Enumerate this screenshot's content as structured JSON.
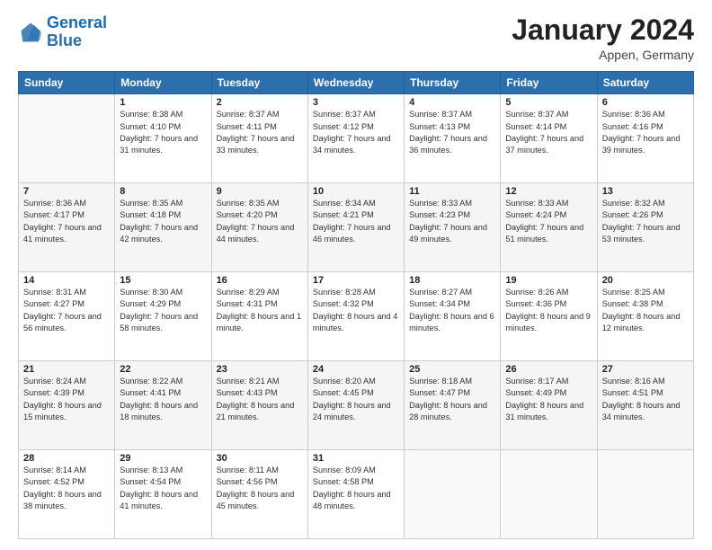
{
  "logo": {
    "line1": "General",
    "line2": "Blue"
  },
  "title": "January 2024",
  "location": "Appen, Germany",
  "days_header": [
    "Sunday",
    "Monday",
    "Tuesday",
    "Wednesday",
    "Thursday",
    "Friday",
    "Saturday"
  ],
  "weeks": [
    [
      {
        "day": "",
        "sunrise": "",
        "sunset": "",
        "daylight": ""
      },
      {
        "day": "1",
        "sunrise": "Sunrise: 8:38 AM",
        "sunset": "Sunset: 4:10 PM",
        "daylight": "Daylight: 7 hours and 31 minutes."
      },
      {
        "day": "2",
        "sunrise": "Sunrise: 8:37 AM",
        "sunset": "Sunset: 4:11 PM",
        "daylight": "Daylight: 7 hours and 33 minutes."
      },
      {
        "day": "3",
        "sunrise": "Sunrise: 8:37 AM",
        "sunset": "Sunset: 4:12 PM",
        "daylight": "Daylight: 7 hours and 34 minutes."
      },
      {
        "day": "4",
        "sunrise": "Sunrise: 8:37 AM",
        "sunset": "Sunset: 4:13 PM",
        "daylight": "Daylight: 7 hours and 36 minutes."
      },
      {
        "day": "5",
        "sunrise": "Sunrise: 8:37 AM",
        "sunset": "Sunset: 4:14 PM",
        "daylight": "Daylight: 7 hours and 37 minutes."
      },
      {
        "day": "6",
        "sunrise": "Sunrise: 8:36 AM",
        "sunset": "Sunset: 4:16 PM",
        "daylight": "Daylight: 7 hours and 39 minutes."
      }
    ],
    [
      {
        "day": "7",
        "sunrise": "Sunrise: 8:36 AM",
        "sunset": "Sunset: 4:17 PM",
        "daylight": "Daylight: 7 hours and 41 minutes."
      },
      {
        "day": "8",
        "sunrise": "Sunrise: 8:35 AM",
        "sunset": "Sunset: 4:18 PM",
        "daylight": "Daylight: 7 hours and 42 minutes."
      },
      {
        "day": "9",
        "sunrise": "Sunrise: 8:35 AM",
        "sunset": "Sunset: 4:20 PM",
        "daylight": "Daylight: 7 hours and 44 minutes."
      },
      {
        "day": "10",
        "sunrise": "Sunrise: 8:34 AM",
        "sunset": "Sunset: 4:21 PM",
        "daylight": "Daylight: 7 hours and 46 minutes."
      },
      {
        "day": "11",
        "sunrise": "Sunrise: 8:33 AM",
        "sunset": "Sunset: 4:23 PM",
        "daylight": "Daylight: 7 hours and 49 minutes."
      },
      {
        "day": "12",
        "sunrise": "Sunrise: 8:33 AM",
        "sunset": "Sunset: 4:24 PM",
        "daylight": "Daylight: 7 hours and 51 minutes."
      },
      {
        "day": "13",
        "sunrise": "Sunrise: 8:32 AM",
        "sunset": "Sunset: 4:26 PM",
        "daylight": "Daylight: 7 hours and 53 minutes."
      }
    ],
    [
      {
        "day": "14",
        "sunrise": "Sunrise: 8:31 AM",
        "sunset": "Sunset: 4:27 PM",
        "daylight": "Daylight: 7 hours and 56 minutes."
      },
      {
        "day": "15",
        "sunrise": "Sunrise: 8:30 AM",
        "sunset": "Sunset: 4:29 PM",
        "daylight": "Daylight: 7 hours and 58 minutes."
      },
      {
        "day": "16",
        "sunrise": "Sunrise: 8:29 AM",
        "sunset": "Sunset: 4:31 PM",
        "daylight": "Daylight: 8 hours and 1 minute."
      },
      {
        "day": "17",
        "sunrise": "Sunrise: 8:28 AM",
        "sunset": "Sunset: 4:32 PM",
        "daylight": "Daylight: 8 hours and 4 minutes."
      },
      {
        "day": "18",
        "sunrise": "Sunrise: 8:27 AM",
        "sunset": "Sunset: 4:34 PM",
        "daylight": "Daylight: 8 hours and 6 minutes."
      },
      {
        "day": "19",
        "sunrise": "Sunrise: 8:26 AM",
        "sunset": "Sunset: 4:36 PM",
        "daylight": "Daylight: 8 hours and 9 minutes."
      },
      {
        "day": "20",
        "sunrise": "Sunrise: 8:25 AM",
        "sunset": "Sunset: 4:38 PM",
        "daylight": "Daylight: 8 hours and 12 minutes."
      }
    ],
    [
      {
        "day": "21",
        "sunrise": "Sunrise: 8:24 AM",
        "sunset": "Sunset: 4:39 PM",
        "daylight": "Daylight: 8 hours and 15 minutes."
      },
      {
        "day": "22",
        "sunrise": "Sunrise: 8:22 AM",
        "sunset": "Sunset: 4:41 PM",
        "daylight": "Daylight: 8 hours and 18 minutes."
      },
      {
        "day": "23",
        "sunrise": "Sunrise: 8:21 AM",
        "sunset": "Sunset: 4:43 PM",
        "daylight": "Daylight: 8 hours and 21 minutes."
      },
      {
        "day": "24",
        "sunrise": "Sunrise: 8:20 AM",
        "sunset": "Sunset: 4:45 PM",
        "daylight": "Daylight: 8 hours and 24 minutes."
      },
      {
        "day": "25",
        "sunrise": "Sunrise: 8:18 AM",
        "sunset": "Sunset: 4:47 PM",
        "daylight": "Daylight: 8 hours and 28 minutes."
      },
      {
        "day": "26",
        "sunrise": "Sunrise: 8:17 AM",
        "sunset": "Sunset: 4:49 PM",
        "daylight": "Daylight: 8 hours and 31 minutes."
      },
      {
        "day": "27",
        "sunrise": "Sunrise: 8:16 AM",
        "sunset": "Sunset: 4:51 PM",
        "daylight": "Daylight: 8 hours and 34 minutes."
      }
    ],
    [
      {
        "day": "28",
        "sunrise": "Sunrise: 8:14 AM",
        "sunset": "Sunset: 4:52 PM",
        "daylight": "Daylight: 8 hours and 38 minutes."
      },
      {
        "day": "29",
        "sunrise": "Sunrise: 8:13 AM",
        "sunset": "Sunset: 4:54 PM",
        "daylight": "Daylight: 8 hours and 41 minutes."
      },
      {
        "day": "30",
        "sunrise": "Sunrise: 8:11 AM",
        "sunset": "Sunset: 4:56 PM",
        "daylight": "Daylight: 8 hours and 45 minutes."
      },
      {
        "day": "31",
        "sunrise": "Sunrise: 8:09 AM",
        "sunset": "Sunset: 4:58 PM",
        "daylight": "Daylight: 8 hours and 48 minutes."
      },
      {
        "day": "",
        "sunrise": "",
        "sunset": "",
        "daylight": ""
      },
      {
        "day": "",
        "sunrise": "",
        "sunset": "",
        "daylight": ""
      },
      {
        "day": "",
        "sunrise": "",
        "sunset": "",
        "daylight": ""
      }
    ]
  ]
}
